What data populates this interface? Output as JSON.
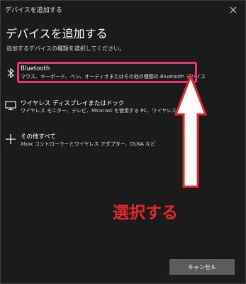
{
  "window": {
    "title": "デバイスを追加する"
  },
  "page": {
    "heading": "デバイスを追加する",
    "subheading": "追加するデバイスの種類を選択してください。"
  },
  "options": [
    {
      "label": "Bluetooth",
      "description": "マウス、キーボード、ペン、オーディオまたはその他の種類の Bluetooth デバイス",
      "icon": "bluetooth-icon"
    },
    {
      "label": "ワイヤレス ディスプレイまたはドック",
      "description": "ワイヤレス モニター、テレビ、Miracast を使用する PC、ワイヤレス ドック",
      "icon": "monitor-icon"
    },
    {
      "label": "その他すべて",
      "description": "Xbox コントローラーとワイヤレス アダプター、DLNA など",
      "icon": "plus-icon"
    }
  ],
  "annotation": {
    "text": "選択する",
    "color": "#e5272c",
    "highlight_color": "#e8336d"
  },
  "footer": {
    "cancel_label": "キャンセル"
  }
}
